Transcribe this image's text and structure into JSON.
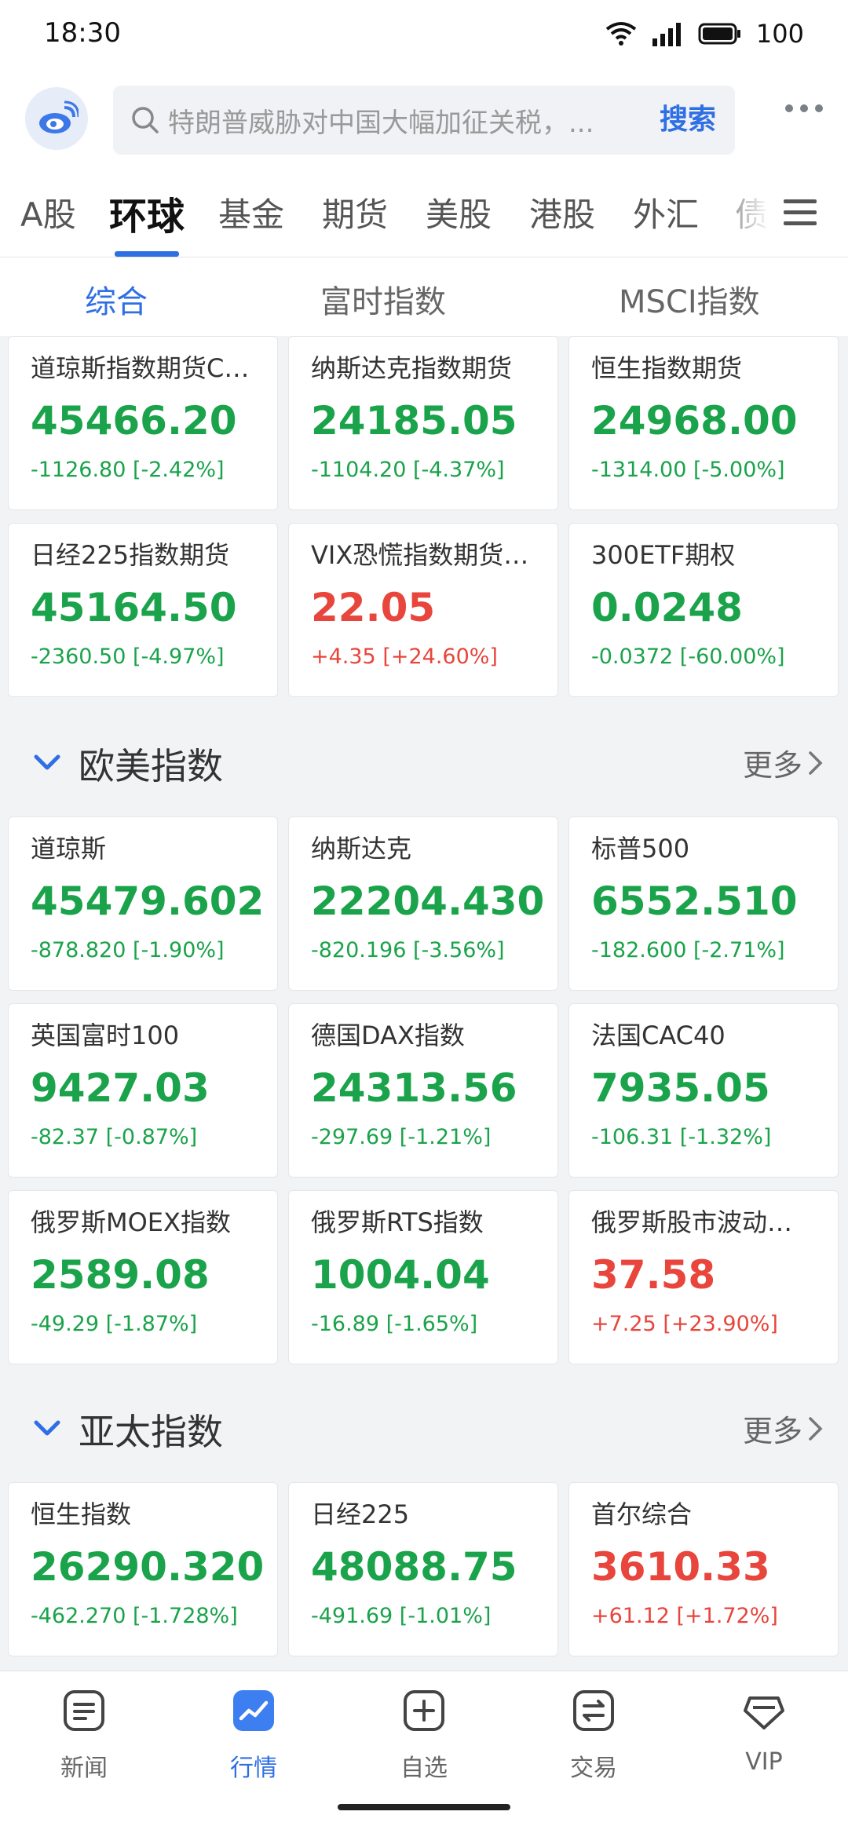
{
  "status_bar": {
    "time": "18:30",
    "battery": "100"
  },
  "search": {
    "placeholder": "特朗普威胁对中国大幅加征关税，...",
    "button": "搜索"
  },
  "top_tabs": [
    {
      "label": "A股"
    },
    {
      "label": "环球"
    },
    {
      "label": "基金"
    },
    {
      "label": "期货"
    },
    {
      "label": "美股"
    },
    {
      "label": "港股"
    },
    {
      "label": "外汇"
    },
    {
      "label": "债券"
    }
  ],
  "sub_tabs": [
    {
      "label": "综合"
    },
    {
      "label": "富时指数"
    },
    {
      "label": "MSCI指数"
    }
  ],
  "futures": [
    {
      "name": "道琼斯指数期货CFD",
      "price": "45466.20",
      "change": "-1126.80 [-2.42%]"
    },
    {
      "name": "纳斯达克指数期货",
      "price": "24185.05",
      "change": "-1104.20 [-4.37%]"
    },
    {
      "name": "恒生指数期货",
      "price": "24968.00",
      "change": "-1314.00 [-5.00%]"
    },
    {
      "name": "日经225指数期货",
      "price": "45164.50",
      "change": "-2360.50 [-4.97%]"
    },
    {
      "name": "VIX恐慌指数期货CFD",
      "price": "22.05",
      "change": "+4.35 [+24.60%]"
    },
    {
      "name": "300ETF期权",
      "price": "0.0248",
      "change": "-0.0372 [-60.00%]"
    }
  ],
  "europe_us": {
    "title": "欧美指数",
    "more": "更多",
    "items": [
      {
        "name": "道琼斯",
        "price": "45479.602",
        "change": "-878.820 [-1.90%]"
      },
      {
        "name": "纳斯达克",
        "price": "22204.430",
        "change": "-820.196 [-3.56%]"
      },
      {
        "name": "标普500",
        "price": "6552.510",
        "change": "-182.600 [-2.71%]"
      },
      {
        "name": "英国富时100",
        "price": "9427.03",
        "change": "-82.37 [-0.87%]"
      },
      {
        "name": "德国DAX指数",
        "price": "24313.56",
        "change": "-297.69 [-1.21%]"
      },
      {
        "name": "法国CAC40",
        "price": "7935.05",
        "change": "-106.31 [-1.32%]"
      },
      {
        "name": "俄罗斯MOEX指数",
        "price": "2589.08",
        "change": "-49.29 [-1.87%]"
      },
      {
        "name": "俄罗斯RTS指数",
        "price": "1004.04",
        "change": "-16.89 [-1.65%]"
      },
      {
        "name": "俄罗斯股市波动率指数",
        "price": "37.58",
        "change": "+7.25 [+23.90%]"
      }
    ]
  },
  "asia_pacific": {
    "title": "亚太指数",
    "more": "更多",
    "items": [
      {
        "name": "恒生指数",
        "price": "26290.320",
        "change": "-462.270 [-1.728%]"
      },
      {
        "name": "日经225",
        "price": "48088.75",
        "change": "-491.69 [-1.01%]"
      },
      {
        "name": "首尔综合",
        "price": "3610.33",
        "change": "+61.12 [+1.72%]"
      }
    ]
  },
  "bottom_nav": [
    {
      "label": "新闻",
      "icon": "news-icon"
    },
    {
      "label": "行情",
      "icon": "market-icon"
    },
    {
      "label": "自选",
      "icon": "watchlist-icon"
    },
    {
      "label": "交易",
      "icon": "trade-icon"
    },
    {
      "label": "VIP",
      "icon": "vip-icon"
    }
  ],
  "colors": {
    "accent": "#2f6fe4",
    "down": "#1aa34a",
    "up": "#e8453c"
  }
}
